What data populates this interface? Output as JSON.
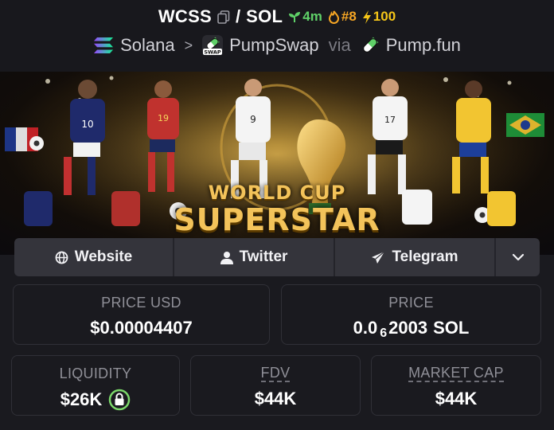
{
  "pair": {
    "base": "WCSS",
    "quote": "SOL",
    "separator": "/"
  },
  "badges": {
    "age": "4m",
    "rank": "#8",
    "boosts": "100"
  },
  "chain": {
    "name": "Solana",
    "dex": "PumpSwap",
    "via_label": "via",
    "launchpad": "Pump.fun",
    "dex_icon_text": "SWAP"
  },
  "banner": {
    "line1": "WORLD CUP",
    "line2": "SUPERSTAR"
  },
  "links": {
    "website": "Website",
    "twitter": "Twitter",
    "telegram": "Telegram"
  },
  "stats": {
    "price_usd": {
      "label": "PRICE USD",
      "value": "$0.00004407"
    },
    "price": {
      "label": "PRICE",
      "prefix": "0.0",
      "zeros": "6",
      "digits": "2003",
      "unit": "SOL"
    },
    "liquidity": {
      "label": "LIQUIDITY",
      "value": "$26K"
    },
    "fdv": {
      "label": "FDV",
      "value": "$44K"
    },
    "market_cap": {
      "label": "MARKET CAP",
      "value": "$44K"
    }
  },
  "colors": {
    "background": "#1a1a1f",
    "age": "#5fd068",
    "rank": "#f5a524",
    "boost": "#f5c518",
    "lock": "#7bd86a",
    "solana_1": "#9945ff",
    "solana_2": "#14f195"
  },
  "icons": [
    "copy-icon",
    "seedling-icon",
    "flame-icon",
    "lightning-icon",
    "solana-logo",
    "pumpswap-logo",
    "pill-icon",
    "globe-icon",
    "user-icon",
    "send-icon",
    "chevron-down-icon",
    "lock-icon"
  ]
}
